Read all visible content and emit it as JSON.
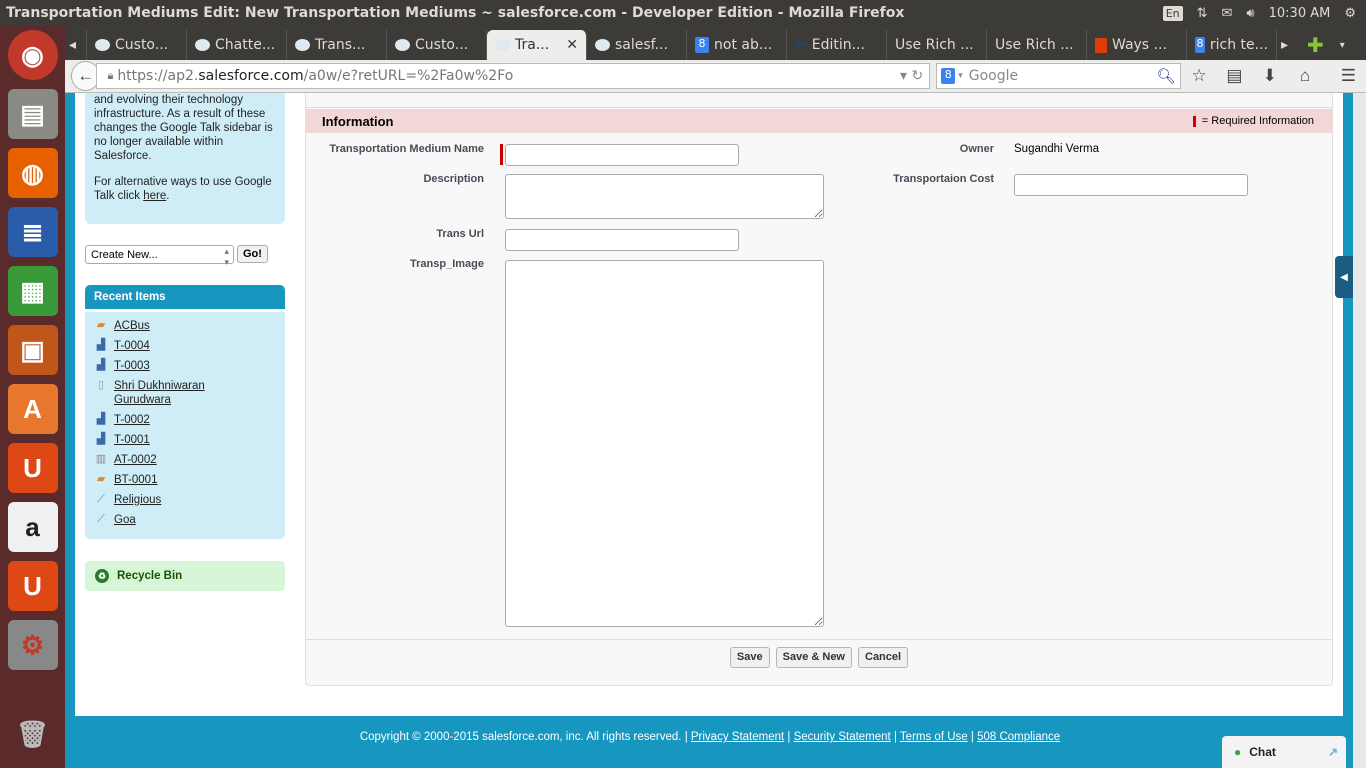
{
  "os": {
    "window_title": "Transportation Mediums Edit: New Transportation Mediums ~ salesforce.com - Developer Edition - Mozilla Firefox",
    "keyboard": "En",
    "clock": "10:30 AM"
  },
  "browser": {
    "tabs": [
      {
        "label": "Custo...",
        "icon": "salesforce-cloud-icon"
      },
      {
        "label": "Chatte...",
        "icon": "salesforce-cloud-icon"
      },
      {
        "label": "Trans...",
        "icon": "salesforce-cloud-icon"
      },
      {
        "label": "Custo...",
        "icon": "salesforce-cloud-icon"
      },
      {
        "label": "Tra...",
        "icon": "salesforce-cloud-icon",
        "active": true
      },
      {
        "label": "salesf...",
        "icon": "salesforce-cloud-icon"
      },
      {
        "label": "not ab...",
        "icon": "google-icon"
      },
      {
        "label": "Editin...",
        "icon": "scissors-icon"
      },
      {
        "label": "Use Rich ...",
        "icon": ""
      },
      {
        "label": "Use Rich ...",
        "icon": ""
      },
      {
        "label": "Ways ...",
        "icon": "office-icon"
      },
      {
        "label": "rich te...",
        "icon": "google-icon"
      }
    ],
    "url_prefix": "https://ap2.",
    "url_domain": "salesforce.com",
    "url_path": "/a0w/e?retURL=%2Fa0w%2Fo",
    "search_placeholder": "Google"
  },
  "sidebar": {
    "message_lines": [
      "and evolving their technology infrastructure. As a result of these changes the Google Talk sidebar is no longer available within Salesforce."
    ],
    "alt_text": "For alternative ways to use Google Talk click ",
    "alt_link": "here",
    "alt_end": ".",
    "create_new": "Create New...",
    "go": "Go!",
    "recent_title": "Recent Items",
    "recent_items": [
      {
        "label": "ACBus",
        "icon": "bus-icon"
      },
      {
        "label": "T-0004",
        "icon": "chart-icon"
      },
      {
        "label": "T-0003",
        "icon": "chart-icon"
      },
      {
        "label": "Shri Dukhniwaran Gurudwara",
        "icon": "document-icon"
      },
      {
        "label": "T-0002",
        "icon": "chart-icon"
      },
      {
        "label": "T-0001",
        "icon": "chart-icon"
      },
      {
        "label": "AT-0002",
        "icon": "building-icon"
      },
      {
        "label": "BT-0001",
        "icon": "bus-icon"
      },
      {
        "label": "Religious",
        "icon": "tag-icon"
      },
      {
        "label": "Goa",
        "icon": "tag-icon"
      }
    ],
    "recycle_bin": "Recycle Bin"
  },
  "form": {
    "section": "Information",
    "required_note": "= Required Information",
    "name_label": "Transportation Medium Name",
    "name_value": "",
    "description_label": "Description",
    "description_value": "",
    "url_label": "Trans Url",
    "url_value": "",
    "image_label": "Transp_Image",
    "image_value": "",
    "owner_label": "Owner",
    "owner_value": "Sugandhi Verma",
    "cost_label": "Transportaion Cost",
    "cost_value": "",
    "save": "Save",
    "save_new": "Save & New",
    "cancel": "Cancel"
  },
  "footer": {
    "copyright": "Copyright © 2000-2015 salesforce.com, inc. All rights reserved. | ",
    "links": [
      "Privacy Statement",
      "Security Statement",
      "Terms of Use",
      "508 Compliance"
    ]
  },
  "chat": "Chat"
}
